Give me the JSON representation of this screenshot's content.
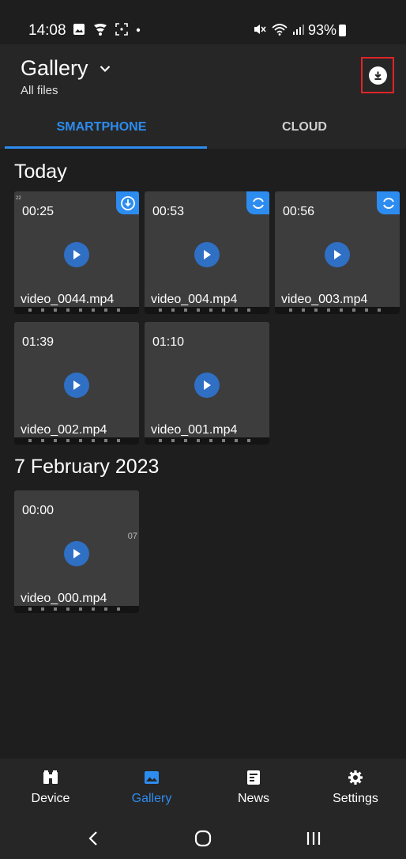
{
  "status_bar": {
    "time": "14:08",
    "battery": "93%",
    "icons_left": [
      "image-icon",
      "pinwheel-icon",
      "screenshot-icon",
      "dot-icon"
    ],
    "icons_right": [
      "mute-icon",
      "wifi-icon",
      "signal-icon",
      "battery-icon"
    ]
  },
  "header": {
    "title": "Gallery",
    "subtitle": "All files",
    "dropdown_icon": "chevron-down-icon",
    "action_icon": "download-icon",
    "highlight_color": "#e0242a"
  },
  "tabs": [
    {
      "label": "SMARTPHONE",
      "active": true
    },
    {
      "label": "CLOUD",
      "active": false
    }
  ],
  "sections": [
    {
      "heading": "Today",
      "items": [
        {
          "duration": "00:25",
          "name": "video_0044.mp4",
          "badge": "download-circle-icon",
          "mark": "22"
        },
        {
          "duration": "00:53",
          "name": "video_004.mp4",
          "badge": "sync-icon"
        },
        {
          "duration": "00:56",
          "name": "video_003.mp4",
          "badge": "sync-icon"
        },
        {
          "duration": "01:39",
          "name": "video_002.mp4"
        },
        {
          "duration": "01:10",
          "name": "video_001.mp4"
        }
      ]
    },
    {
      "heading": "7 February 2023",
      "items": [
        {
          "duration": "00:00",
          "name": "video_000.mp4",
          "edge": "07"
        }
      ]
    }
  ],
  "bottom_nav": [
    {
      "label": "Device",
      "icon": "binoculars-icon",
      "active": false
    },
    {
      "label": "Gallery",
      "icon": "image-icon",
      "active": true
    },
    {
      "label": "News",
      "icon": "news-icon",
      "active": false
    },
    {
      "label": "Settings",
      "icon": "gear-icon",
      "active": false
    }
  ],
  "system_nav": [
    "back-icon",
    "home-icon",
    "recents-icon"
  ],
  "colors": {
    "accent": "#2d8cf0",
    "background": "#1e1e1e",
    "surface": "#262626",
    "thumbnail": "#3d3d3d"
  }
}
